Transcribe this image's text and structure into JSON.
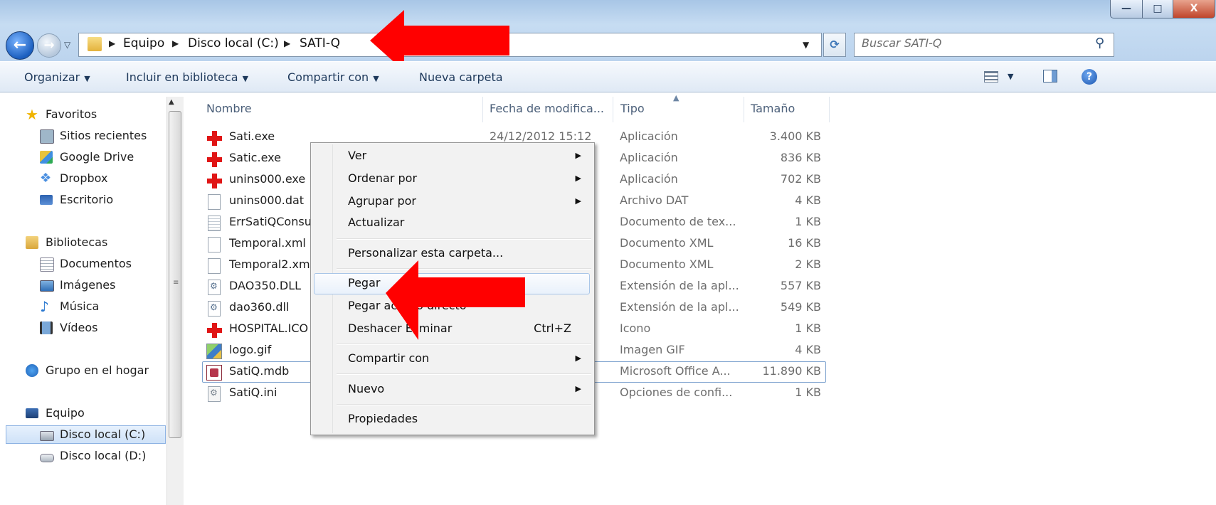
{
  "window": {
    "buttons": {
      "minimize": "—",
      "maximize": "□",
      "close": "X"
    }
  },
  "address": {
    "crumbs": [
      "Equipo",
      "Disco local (C:)",
      "SATI-Q"
    ]
  },
  "search": {
    "placeholder": "Buscar SATI-Q"
  },
  "toolbar": {
    "organize": "Organizar",
    "include_library": "Incluir en biblioteca",
    "share_with": "Compartir con",
    "new_folder": "Nueva carpeta"
  },
  "nav": {
    "favorites": "Favoritos",
    "recent": "Sitios recientes",
    "google_drive": "Google Drive",
    "dropbox": "Dropbox",
    "desktop": "Escritorio",
    "libraries": "Bibliotecas",
    "documents": "Documentos",
    "images": "Imágenes",
    "music": "Música",
    "videos": "Vídeos",
    "homegroup": "Grupo en el hogar",
    "computer": "Equipo",
    "disk_c": "Disco local (C:)",
    "disk_d": "Disco local (D:)"
  },
  "columns": {
    "name": "Nombre",
    "date": "Fecha de modifica...",
    "type": "Tipo",
    "size": "Tamaño"
  },
  "files": [
    {
      "name": "Sati.exe",
      "date": "24/12/2012 15:12",
      "type": "Aplicación",
      "size": "3.400 KB",
      "icon": "red-cross"
    },
    {
      "name": "Satic.exe",
      "date": "",
      "type": "Aplicación",
      "size": "836 KB",
      "icon": "red-cross"
    },
    {
      "name": "unins000.exe",
      "date": "",
      "type": "Aplicación",
      "size": "702 KB",
      "icon": "red-cross"
    },
    {
      "name": "unins000.dat",
      "date": "",
      "type": "Archivo DAT",
      "size": "4 KB",
      "icon": "doc"
    },
    {
      "name": "ErrSatiQConsu",
      "date": "",
      "type": "Documento de tex...",
      "size": "1 KB",
      "icon": "txt"
    },
    {
      "name": "Temporal.xml",
      "date": "",
      "type": "Documento XML",
      "size": "16 KB",
      "icon": "doc"
    },
    {
      "name": "Temporal2.xm",
      "date": "",
      "type": "Documento XML",
      "size": "2 KB",
      "icon": "doc"
    },
    {
      "name": "DAO350.DLL",
      "date": "",
      "type": "Extensión de la apl...",
      "size": "557 KB",
      "icon": "dll"
    },
    {
      "name": "dao360.dll",
      "date": "",
      "type": "Extensión de la apl...",
      "size": "549 KB",
      "icon": "dll"
    },
    {
      "name": "HOSPITAL.ICO",
      "date": "",
      "type": "Icono",
      "size": "1 KB",
      "icon": "red-cross"
    },
    {
      "name": "logo.gif",
      "date": "",
      "type": "Imagen GIF",
      "size": "4 KB",
      "icon": "gif"
    },
    {
      "name": "SatiQ.mdb",
      "date": "",
      "type": "Microsoft Office A...",
      "size": "11.890 KB",
      "icon": "mdb"
    },
    {
      "name": "SatiQ.ini",
      "date": "",
      "type": "Opciones de confi...",
      "size": "1 KB",
      "icon": "ini"
    }
  ],
  "context_menu": {
    "view": "Ver",
    "sort_by": "Ordenar por",
    "group_by": "Agrupar por",
    "refresh": "Actualizar",
    "customize": "Personalizar esta carpeta...",
    "paste": "Pegar",
    "paste_shortcut": "Pegar acceso directo",
    "undo_delete": "Deshacer Eliminar",
    "undo_shortcut": "Ctrl+Z",
    "share_with": "Compartir con",
    "new": "Nuevo",
    "properties": "Propiedades"
  },
  "colors": {
    "annotation_arrow": "#ff0000",
    "selection_border": "#7da2ce"
  }
}
